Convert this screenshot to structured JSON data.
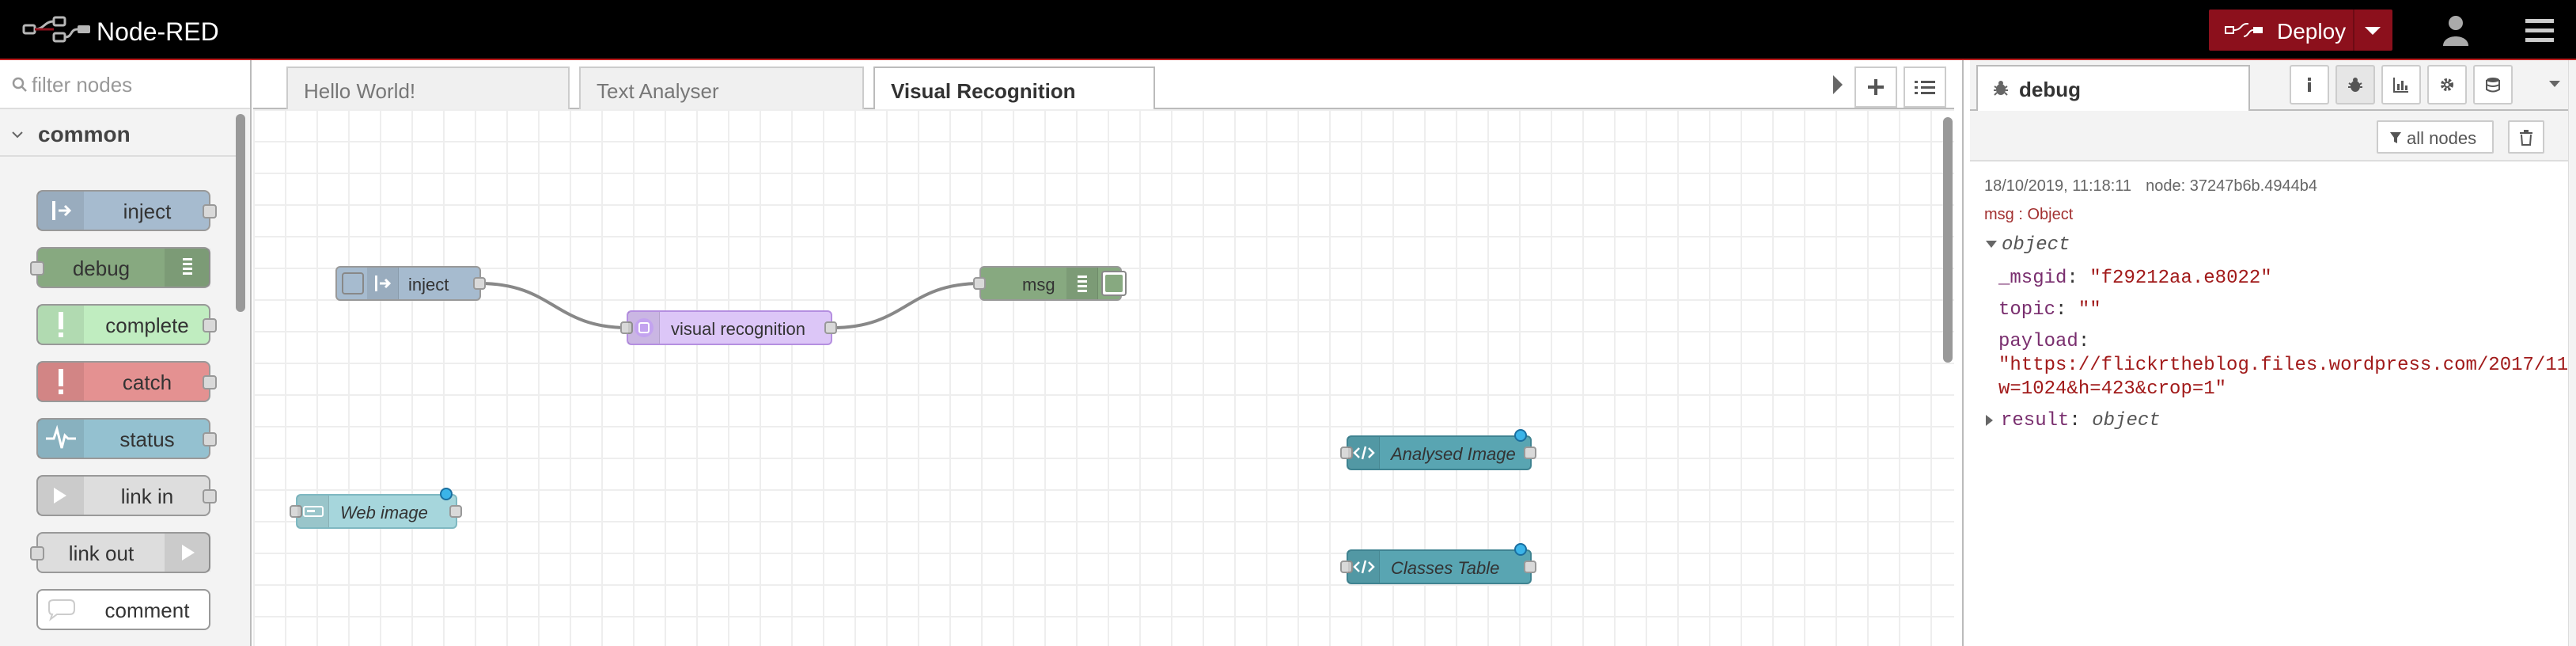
{
  "header": {
    "title": "Node-RED",
    "deploy_label": "Deploy"
  },
  "palette": {
    "search_placeholder": "filter nodes",
    "category": "common",
    "nodes": [
      {
        "label": "inject",
        "color": "#a6bbcf"
      },
      {
        "label": "debug",
        "color": "#87a980"
      },
      {
        "label": "complete",
        "color": "#c0edc0"
      },
      {
        "label": "catch",
        "color": "#e49191"
      },
      {
        "label": "status",
        "color": "#94c1d0"
      },
      {
        "label": "link in",
        "color": "#dddddd"
      },
      {
        "label": "link out",
        "color": "#dddddd"
      },
      {
        "label": "comment",
        "color": "#ffffff"
      }
    ]
  },
  "tabs": [
    {
      "label": "Hello World!",
      "active": false
    },
    {
      "label": "Text Analyser",
      "active": false
    },
    {
      "label": "Visual Recognition",
      "active": true
    }
  ],
  "flow_nodes": {
    "inject": {
      "label": "inject",
      "color": "#a6bbcf"
    },
    "visual_recognition": {
      "label": "visual recognition",
      "color": "#dcc6f7"
    },
    "msg": {
      "label": "msg",
      "color": "#87a980"
    },
    "analysed_image": {
      "label": "Analysed Image",
      "color": "#59a5b2"
    },
    "classes_table": {
      "label": "Classes Table",
      "color": "#59a5b2"
    },
    "web_image": {
      "label": "Web image",
      "color": "#a6d6dc"
    }
  },
  "sidebar": {
    "active_tab": "debug",
    "filter_label": "all nodes",
    "message": {
      "timestamp": "18/10/2019, 11:18:11",
      "node": "node: 37247b6b.4944b4",
      "topic_line": "msg : Object",
      "root": "object",
      "msgid_key": "_msgid",
      "msgid_value": "\"f29212aa.e8022\"",
      "topic_key": "topic",
      "topic_value": "\"\"",
      "payload_key": "payload",
      "payload_line1": "\"https://flickrtheblog.files.wordpress.com/2017/11/",
      "payload_line2": "w=1024&h=423&crop=1\"",
      "result_key": "result",
      "result_value": "object"
    }
  }
}
